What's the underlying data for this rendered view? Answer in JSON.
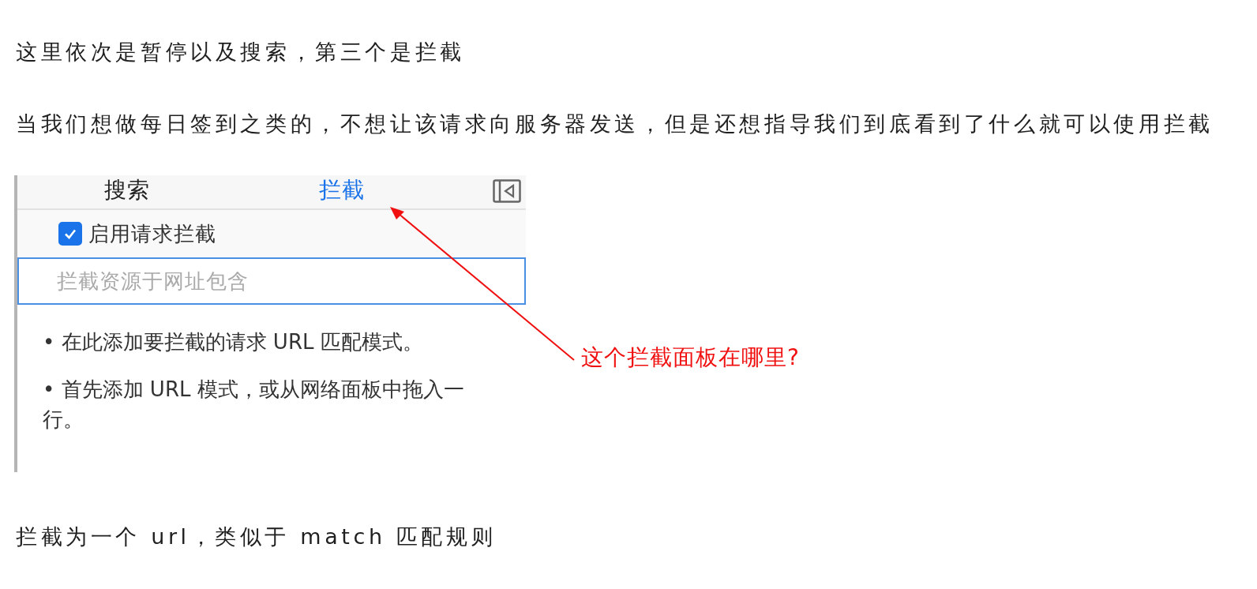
{
  "paragraphs_top": [
    "这里依次是暂停以及搜索，第三个是拦截",
    "当我们想做每日签到之类的，不想让该请求向服务器发送，但是还想指导我们到底看到了什么就可以使用拦截"
  ],
  "screenshot": {
    "tabs": [
      {
        "label": "搜索",
        "selected": false
      },
      {
        "label": "拦截",
        "selected": true
      }
    ],
    "enable_checkbox": {
      "label": "启用请求拦截",
      "checked": true
    },
    "pattern_field": {
      "placeholder": "拦截资源于网址包含"
    },
    "hints": [
      "• 在此添加要拦截的请求 URL 匹配模式。",
      "• 首先添加 URL 模式，或从网络面板中拖入一行。"
    ]
  },
  "annotation": {
    "text": "这个拦截面板在哪里?"
  },
  "paragraphs_bottom": [
    "拦截为一个 url，类似于 match 匹配规则"
  ]
}
